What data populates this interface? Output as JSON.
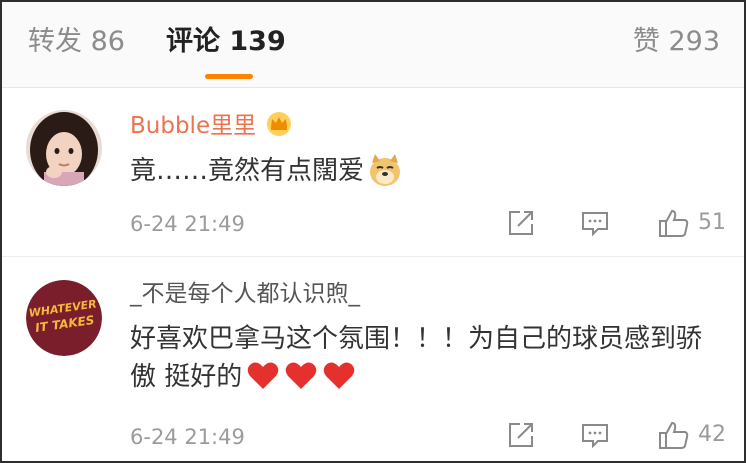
{
  "tabs": {
    "repost": "转发 86",
    "comments": "评论 139",
    "likes": "赞 293"
  },
  "colors": {
    "accent": "#ff8200",
    "vip_name": "#eb7350",
    "meta_gray": "#9b9b9b"
  },
  "comments": [
    {
      "username": "Bubble里里",
      "badge_icon": "crown-icon",
      "text": "竟……竟然有点闊爱",
      "emoji_icon": "doge-emoji-icon",
      "time": "6-24 21:49",
      "likes": "51"
    },
    {
      "username": "_不是每个人都认识煦_",
      "avatar_text": "WHATEVER IT TAKES",
      "text": "好喜欢巴拿马这个氛围！！！为自己的球员感到骄傲 挺好的",
      "heart_icons": [
        "heart-icon",
        "heart-icon",
        "heart-icon"
      ],
      "time": "6-24 21:49",
      "likes": "42"
    }
  ]
}
